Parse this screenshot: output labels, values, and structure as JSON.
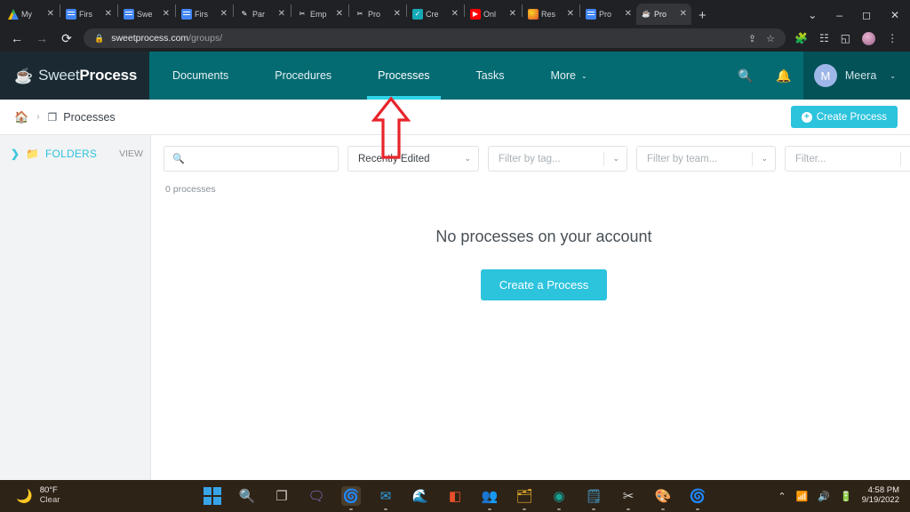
{
  "browser": {
    "tabs": [
      {
        "label": "My",
        "favicon": "google-drive-icon",
        "active": false
      },
      {
        "label": "Firs",
        "favicon": "google-docs-icon",
        "active": false
      },
      {
        "label": "Swe",
        "favicon": "google-docs-icon",
        "active": false
      },
      {
        "label": "Firs",
        "favicon": "google-docs-icon",
        "active": false
      },
      {
        "label": "Par",
        "favicon": "pen-icon",
        "active": false
      },
      {
        "label": "Emp",
        "favicon": "scissors-icon",
        "active": false
      },
      {
        "label": "Pro",
        "favicon": "scissors-icon",
        "active": false
      },
      {
        "label": "Cre",
        "favicon": "check-circle-icon",
        "active": false
      },
      {
        "label": "Onl",
        "favicon": "youtube-icon",
        "active": false
      },
      {
        "label": "Res",
        "favicon": "orange-globe-icon",
        "active": false
      },
      {
        "label": "Pro",
        "favicon": "google-docs-icon",
        "active": false
      },
      {
        "label": "Pro",
        "favicon": "sweetprocess-icon",
        "active": true
      }
    ],
    "new_tab_label": "+",
    "window_controls": {
      "list": "⌄",
      "minimize": "–",
      "maximize": "◻",
      "close": "✕"
    },
    "nav": {
      "back": "←",
      "forward": "→",
      "reload": "⟳"
    },
    "url_domain": "sweetprocess.com",
    "url_path": "/groups/",
    "lock_icon": "🔒",
    "toolbar_icons": [
      "share-icon",
      "bookmark-star-icon",
      "extensions-puzzle-icon",
      "reading-list-icon",
      "side-panel-icon",
      "profile-avatar-icon",
      "three-dot-menu-icon"
    ]
  },
  "app": {
    "logo": {
      "light": "Sweet",
      "bold": "Process"
    },
    "nav_items": [
      {
        "label": "Documents",
        "active": false
      },
      {
        "label": "Procedures",
        "active": false
      },
      {
        "label": "Processes",
        "active": true
      },
      {
        "label": "Tasks",
        "active": false
      },
      {
        "label": "More",
        "active": false,
        "caret": "⌄"
      }
    ],
    "search_icon": "search-icon",
    "bell_icon": "notification-bell-icon",
    "user": {
      "initial": "M",
      "name": "Meera",
      "caret": "⌄"
    },
    "accent_color": "#2cc3dd",
    "header_color": "#046b72"
  },
  "breadcrumb": {
    "home_icon": "home-icon",
    "separator": "›",
    "page_icon": "documents-icon",
    "page_label": "Processes",
    "create_button": {
      "label": "Create Process",
      "icon": "plus-circle-icon"
    }
  },
  "sidebar": {
    "expand_icon": "chevron-right-icon",
    "folder_icon": "folder-icon",
    "folders_label": "FOLDERS",
    "view_label": "VIEW"
  },
  "filters": {
    "search": {
      "value": "",
      "placeholder": "",
      "icon": "search-icon"
    },
    "sort": {
      "value": "Recently Edited",
      "caret": "⌄"
    },
    "tag": {
      "value": "Filter by tag...",
      "caret": "⌄"
    },
    "team": {
      "value": "Filter by team...",
      "caret": "⌄"
    },
    "other": {
      "value": "Filter...",
      "caret": "⌄"
    }
  },
  "main": {
    "count_label": "0 processes",
    "empty_title": "No processes on your account",
    "empty_button": "Create a Process"
  },
  "annotation": {
    "shape": "up-arrow-outline",
    "color": "#e8242a",
    "points_at": "Processes"
  },
  "taskbar": {
    "weather": {
      "temp": "80°F",
      "condition": "Clear",
      "icon": "moon-icon"
    },
    "items": [
      {
        "name": "start-windows-icon"
      },
      {
        "name": "search-icon"
      },
      {
        "name": "task-view-icon"
      },
      {
        "name": "chat-teams-icon"
      },
      {
        "name": "google-chrome-icon"
      },
      {
        "name": "mail-icon"
      },
      {
        "name": "microsoft-edge-icon"
      },
      {
        "name": "office-icon"
      },
      {
        "name": "microsoft-teams-icon"
      },
      {
        "name": "file-explorer-icon"
      },
      {
        "name": "wondershare-icon"
      },
      {
        "name": "notepad-icon"
      },
      {
        "name": "snipping-tool-icon"
      },
      {
        "name": "paint-icon"
      },
      {
        "name": "chrome-profile-icon"
      }
    ],
    "tray": {
      "chevron": "⌃",
      "wifi": "wifi-icon",
      "volume": "speaker-icon",
      "battery": "battery-icon"
    },
    "clock": {
      "time": "4:58 PM",
      "date": "9/19/2022"
    }
  }
}
